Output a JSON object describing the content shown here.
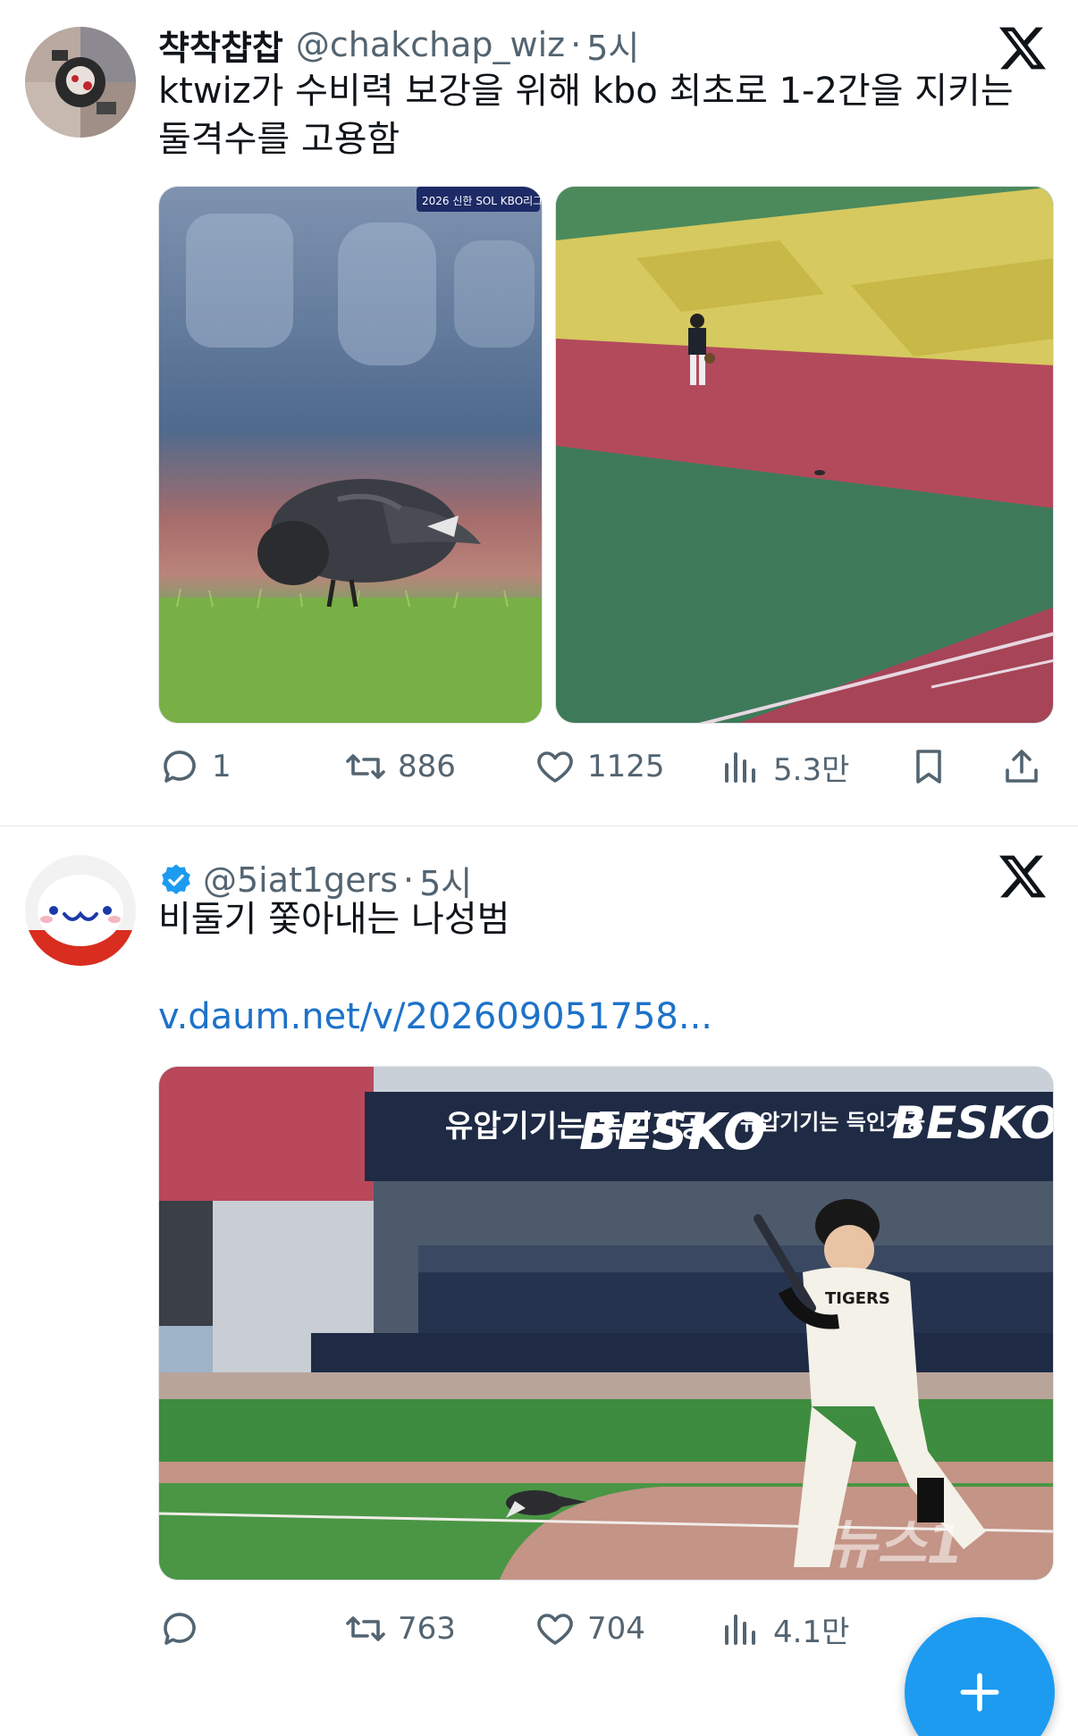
{
  "tweets": [
    {
      "display_name": "챡착챱찹",
      "handle": "@chakchap_wiz",
      "separator": "·",
      "time": "5시",
      "text": "ktwiz가 수비력 보강을 위해 kbo 최초로 1-2간을 지키는 둘격수를 고용함",
      "broadcast_badge": "2026 신한 SOL KBO리그",
      "actions": {
        "replies": "1",
        "retweets": "886",
        "likes": "1125",
        "views": "5.3만"
      }
    },
    {
      "display_name": "",
      "verified": true,
      "handle": "@5iat1gers",
      "separator": "·",
      "time": "5시",
      "text": "비둘기 쫓아내는 나성범",
      "link": "v.daum.net/v/202609051758...",
      "banner_texts": [
        "유압기기는 득인기공",
        "BESKO",
        "유압기기는 득인기공",
        "BESKO"
      ],
      "jersey_text": "TIGERS",
      "watermark": "뉴스1",
      "actions": {
        "replies": "",
        "retweets": "763",
        "likes": "704",
        "views": "4.1만"
      }
    }
  ],
  "colors": {
    "accent": "#1d9bf0",
    "link": "#1d72c9",
    "secondary_text": "#536471",
    "verified": "#1d9bf0"
  },
  "icons": [
    "x-logo-icon",
    "reply-icon",
    "retweet-icon",
    "like-icon",
    "views-icon",
    "bookmark-icon",
    "share-icon",
    "verified-icon",
    "compose-plus-icon"
  ]
}
